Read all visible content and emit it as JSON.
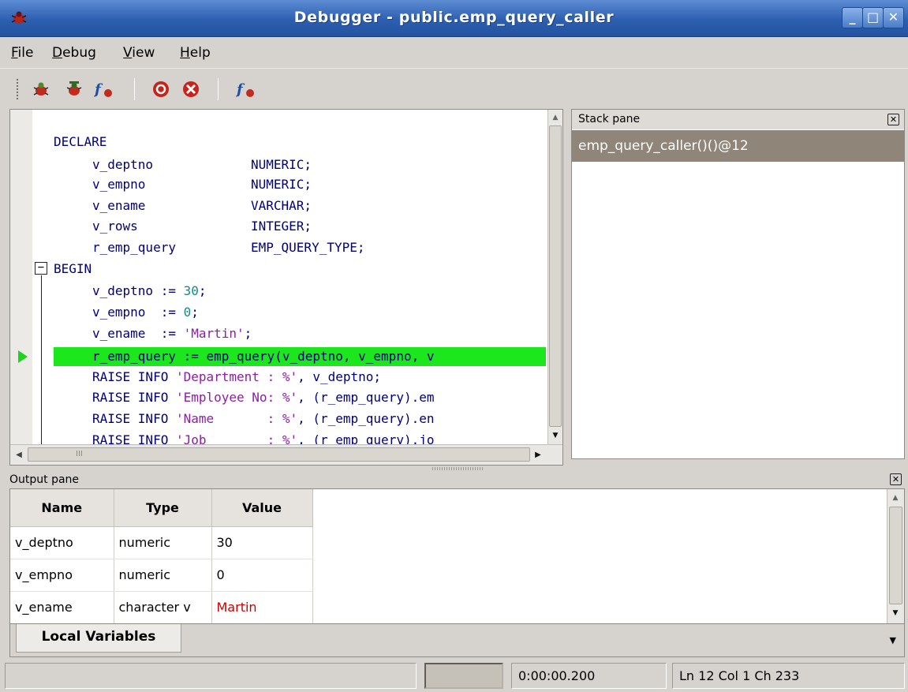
{
  "window": {
    "title": "Debugger - public.emp_query_caller"
  },
  "menu": {
    "file": "File",
    "debug": "Debug",
    "view": "View",
    "help": "Help"
  },
  "toolbar": {
    "icons": [
      "step-into-icon",
      "step-over-icon",
      "continue-icon",
      "toggle-breakpoint-icon",
      "clear-breakpoints-icon",
      "stop-icon"
    ]
  },
  "editor": {
    "lines": [
      {
        "indent": 0,
        "name": "DECLARE",
        "type": ""
      },
      {
        "indent": 1,
        "name": "v_deptno",
        "type": "NUMERIC;"
      },
      {
        "indent": 1,
        "name": "v_empno",
        "type": "NUMERIC;"
      },
      {
        "indent": 1,
        "name": "v_ename",
        "type": "VARCHAR;"
      },
      {
        "indent": 1,
        "name": "v_rows",
        "type": "INTEGER;"
      },
      {
        "indent": 1,
        "name": "r_emp_query",
        "type": "EMP_QUERY_TYPE;"
      }
    ],
    "begin": "BEGIN",
    "assign_deptno": {
      "lhs": "v_deptno := ",
      "val": "30",
      "end": ";"
    },
    "assign_empno": {
      "lhs": "v_empno  := ",
      "val": "0",
      "end": ";"
    },
    "assign_ename": {
      "lhs": "v_ename  := ",
      "val": "'Martin'",
      "end": ";"
    },
    "current_line": "r_emp_query := emp_query(v_deptno, v_empno, v",
    "raise_lines": [
      {
        "kw": "RAISE INFO ",
        "str": "'Department : %'",
        "rest": ", v_deptno;"
      },
      {
        "kw": "RAISE INFO ",
        "str": "'Employee No: %'",
        "rest": ", (r_emp_query).em"
      },
      {
        "kw": "RAISE INFO ",
        "str": "'Name       : %'",
        "rest": ", (r_emp_query).en"
      },
      {
        "kw": "RAISE INFO ",
        "str": "'Job        : %'",
        "rest": ", (r_emp_query).jo"
      }
    ],
    "hscroll_marker": "III"
  },
  "stack_pane": {
    "title": "Stack pane",
    "frames": [
      "emp_query_caller()()@12"
    ]
  },
  "output_pane": {
    "title": "Output pane",
    "columns": [
      "Name",
      "Type",
      "Value"
    ],
    "rows": [
      {
        "name": "v_deptno",
        "type": "numeric",
        "value": "30",
        "changed": false
      },
      {
        "name": "v_empno",
        "type": "numeric",
        "value": "0",
        "changed": false
      },
      {
        "name": "v_ename",
        "type": "character v",
        "value": "Martin",
        "changed": true
      }
    ],
    "tabs": [
      "Local Variables"
    ]
  },
  "status": {
    "message": "",
    "elapsed": "0:00:00.200",
    "position": "Ln 12 Col 1 Ch 233"
  },
  "colors": {
    "current_line": "#1ce61c",
    "stack_selected": "#8f8578",
    "changed_value": "#c80000",
    "titlebar": "#2d5fb0"
  }
}
